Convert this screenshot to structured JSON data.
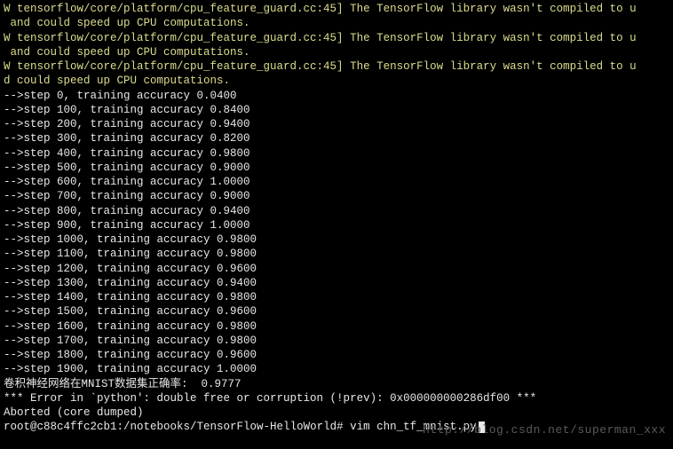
{
  "warnings": [
    "W tensorflow/core/platform/cpu_feature_guard.cc:45] The TensorFlow library wasn't compiled to u",
    " and could speed up CPU computations.",
    "W tensorflow/core/platform/cpu_feature_guard.cc:45] The TensorFlow library wasn't compiled to u",
    " and could speed up CPU computations.",
    "W tensorflow/core/platform/cpu_feature_guard.cc:45] The TensorFlow library wasn't compiled to u",
    "d could speed up CPU computations."
  ],
  "training_steps": [
    {
      "step": 0,
      "accuracy": "0.0400"
    },
    {
      "step": 100,
      "accuracy": "0.8400"
    },
    {
      "step": 200,
      "accuracy": "0.9400"
    },
    {
      "step": 300,
      "accuracy": "0.8200"
    },
    {
      "step": 400,
      "accuracy": "0.9800"
    },
    {
      "step": 500,
      "accuracy": "0.9000"
    },
    {
      "step": 600,
      "accuracy": "1.0000"
    },
    {
      "step": 700,
      "accuracy": "0.9000"
    },
    {
      "step": 800,
      "accuracy": "0.9400"
    },
    {
      "step": 900,
      "accuracy": "1.0000"
    },
    {
      "step": 1000,
      "accuracy": "0.9800"
    },
    {
      "step": 1100,
      "accuracy": "0.9800"
    },
    {
      "step": 1200,
      "accuracy": "0.9600"
    },
    {
      "step": 1300,
      "accuracy": "0.9400"
    },
    {
      "step": 1400,
      "accuracy": "0.9800"
    },
    {
      "step": 1500,
      "accuracy": "0.9600"
    },
    {
      "step": 1600,
      "accuracy": "0.9800"
    },
    {
      "step": 1700,
      "accuracy": "0.9800"
    },
    {
      "step": 1800,
      "accuracy": "0.9600"
    },
    {
      "step": 1900,
      "accuracy": "1.0000"
    }
  ],
  "result_line": "卷积神经网络在MNIST数据集正确率:  0.9777",
  "error_line": "*** Error in `python': double free or corruption (!prev): 0x000000000286df00 ***",
  "aborted_line": "Aborted (core dumped)",
  "prompt": {
    "user_host": "root@c88c4ffc2cb1",
    "path": ":/notebooks/TensorFlow-HelloWorld#",
    "command": " vim chn_tf_mnist.py"
  },
  "watermark": "http://blog.csdn.net/superman_xxx"
}
